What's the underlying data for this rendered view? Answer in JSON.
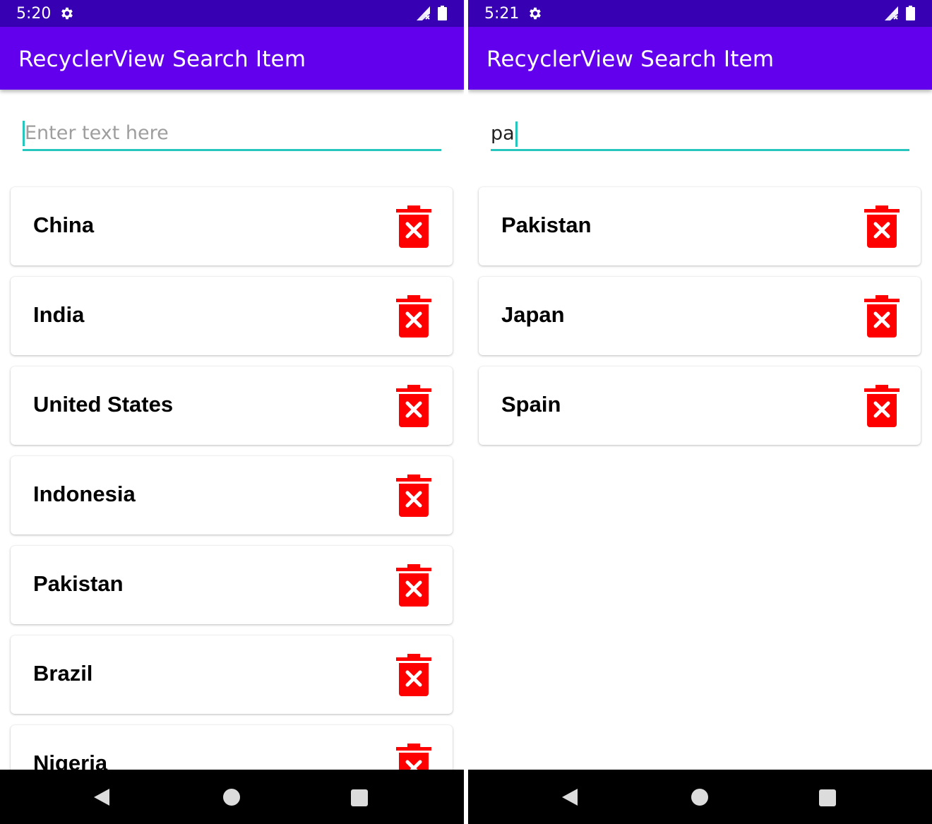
{
  "colors": {
    "status_bar": "#3700b3",
    "app_bar": "#6200ee",
    "accent": "#26c6be",
    "delete_icon": "#ff0000",
    "nav_bar": "#000000"
  },
  "screens": [
    {
      "status_bar": {
        "time": "5:20",
        "icons": [
          "settings-icon",
          "signal-icon",
          "battery-icon"
        ]
      },
      "app_bar": {
        "title": "RecyclerView Search Item"
      },
      "search": {
        "placeholder": "Enter text here",
        "value": ""
      },
      "items": [
        {
          "label": "China",
          "icon": "delete-icon"
        },
        {
          "label": "India",
          "icon": "delete-icon"
        },
        {
          "label": "United States",
          "icon": "delete-icon"
        },
        {
          "label": "Indonesia",
          "icon": "delete-icon"
        },
        {
          "label": "Pakistan",
          "icon": "delete-icon"
        },
        {
          "label": "Brazil",
          "icon": "delete-icon"
        },
        {
          "label": "Nigeria",
          "icon": "delete-icon"
        }
      ],
      "nav_bar": {
        "icons": [
          "back-icon",
          "home-icon",
          "recents-icon"
        ]
      }
    },
    {
      "status_bar": {
        "time": "5:21",
        "icons": [
          "settings-icon",
          "signal-icon",
          "battery-icon"
        ]
      },
      "app_bar": {
        "title": "RecyclerView Search Item"
      },
      "search": {
        "placeholder": "Enter text here",
        "value": "pa"
      },
      "items": [
        {
          "label": "Pakistan",
          "icon": "delete-icon"
        },
        {
          "label": "Japan",
          "icon": "delete-icon"
        },
        {
          "label": "Spain",
          "icon": "delete-icon"
        }
      ],
      "nav_bar": {
        "icons": [
          "back-icon",
          "home-icon",
          "recents-icon"
        ]
      }
    }
  ]
}
